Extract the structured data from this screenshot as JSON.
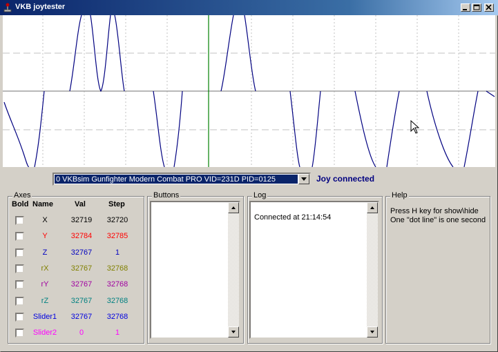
{
  "window": {
    "title": "VKB joytester"
  },
  "device": {
    "selected": "0 VKBsim Gunfighter Modern Combat PRO  VID=231D PID=0125",
    "status": "Joy connected"
  },
  "axes": {
    "label": "Axes",
    "headers": {
      "bold": "Bold",
      "name": "Name",
      "val": "Val",
      "step": "Step"
    },
    "rows": [
      {
        "name": "X",
        "val": "32719",
        "step": "32720",
        "color": "#000000"
      },
      {
        "name": "Y",
        "val": "32784",
        "step": "32785",
        "color": "#ff0000"
      },
      {
        "name": "Z",
        "val": "32767",
        "step": "1",
        "color": "#0000c0"
      },
      {
        "name": "rX",
        "val": "32767",
        "step": "32768",
        "color": "#808000"
      },
      {
        "name": "rY",
        "val": "32767",
        "step": "32768",
        "color": "#a000a0"
      },
      {
        "name": "rZ",
        "val": "32767",
        "step": "32768",
        "color": "#008080"
      },
      {
        "name": "Slider1",
        "val": "32767",
        "step": "32768",
        "color": "#0000e0"
      },
      {
        "name": "Slider2",
        "val": "0",
        "step": "1",
        "color": "#ff00ff"
      }
    ]
  },
  "buttons": {
    "label": "Buttons"
  },
  "log": {
    "label": "Log",
    "lines": [
      "Connected at 21:14:54"
    ]
  },
  "help": {
    "label": "Help",
    "line1": "Press H key for show\\hide",
    "line2": "One \"dot line\" is one second"
  },
  "graph": {
    "trace_color": "#000080",
    "marker_color": "#008000",
    "grid_color": "#c0c0c0"
  },
  "icons": {
    "app": "joystick-icon",
    "minimize": "minimize-icon",
    "maximize": "maximize-icon",
    "close": "close-icon",
    "dropdown": "chevron-down-icon",
    "scroll_up": "arrow-up-icon",
    "scroll_down": "arrow-down-icon",
    "cursor": "mouse-pointer-icon"
  }
}
